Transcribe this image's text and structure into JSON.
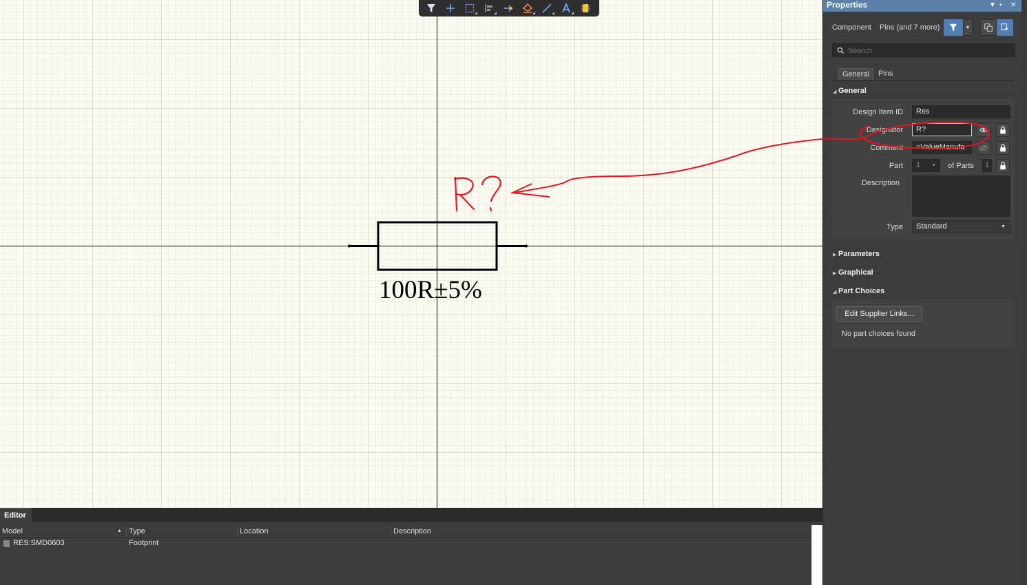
{
  "schematic": {
    "designator_scribble": "R?",
    "comment_value": "100R±5%"
  },
  "properties": {
    "title": "Properties",
    "object_kind": "Component",
    "object_scope": "Pins (and 7 more)",
    "search_placeholder": "Search",
    "tabs": [
      "General",
      "Pins"
    ],
    "sections": {
      "general": "General",
      "parameters": "Parameters",
      "graphical": "Graphical",
      "part_choices": "Part Choices"
    },
    "general": {
      "design_item_id_label": "Design Item ID",
      "design_item_id_value": "Res",
      "designator_label": "Designator",
      "designator_value": "R?",
      "comment_label": "Comment",
      "comment_value": "=ValueManufa",
      "part_label": "Part",
      "part_value": "1",
      "of_parts_label": "of Parts",
      "of_parts_value": "1",
      "description_label": "Description",
      "description_value": "",
      "type_label": "Type",
      "type_value": "Standard"
    },
    "part_choices": {
      "edit_button": "Edit Supplier Links...",
      "empty_message": "No part choices found"
    }
  },
  "editor": {
    "tab_label": "Editor",
    "columns": [
      "Model",
      "Type",
      "Location",
      "Description"
    ],
    "rows": [
      {
        "model": "RES:SMD0603",
        "type": "Footprint",
        "location": "",
        "description": ""
      }
    ]
  },
  "colors": {
    "canvas_bg": "#fbfaf1",
    "panel_bg": "#3c3c3c",
    "title_bar": "#5b81a8",
    "annotation_red": "#e8141c",
    "accent_blue": "#4f7fb3"
  }
}
